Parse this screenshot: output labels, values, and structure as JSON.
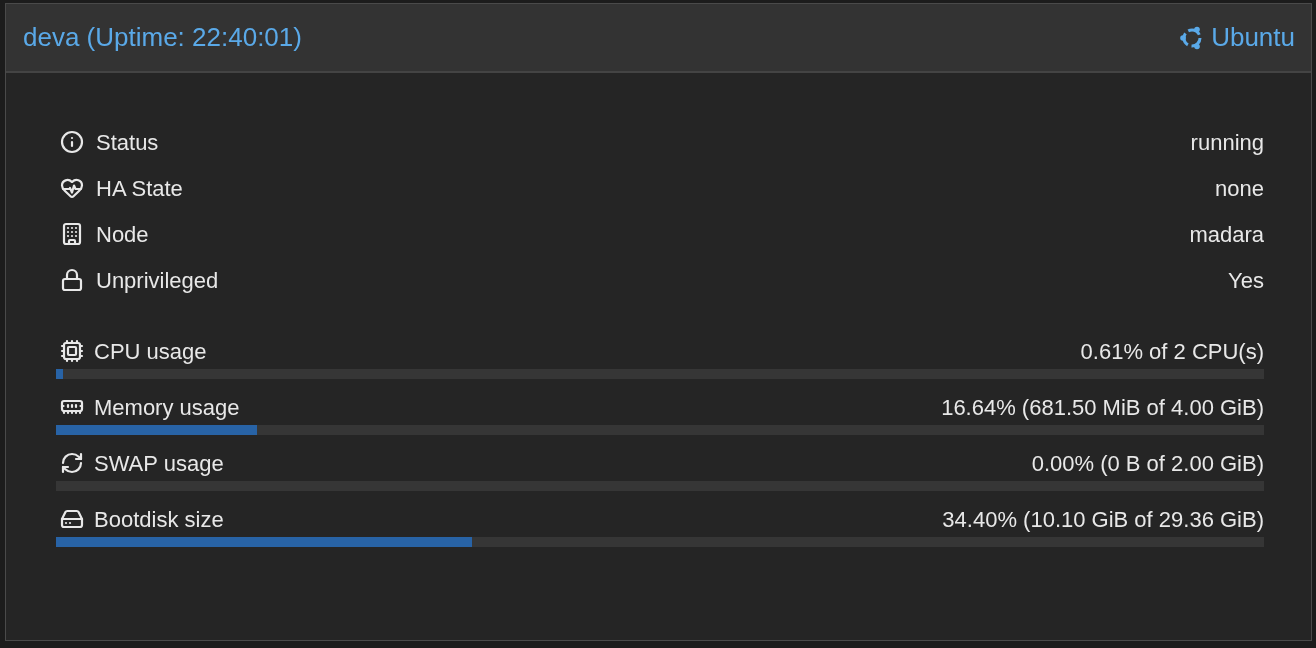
{
  "header": {
    "title": "deva (Uptime: 22:40:01)",
    "os": "Ubuntu"
  },
  "rows": [
    {
      "kind": "info",
      "label": "Status",
      "value": "running"
    },
    {
      "kind": "info",
      "label": "HA State",
      "value": "none"
    },
    {
      "kind": "info",
      "label": "Node",
      "value": "madara"
    },
    {
      "kind": "info",
      "label": "Unprivileged",
      "value": "Yes"
    },
    {
      "kind": "usage",
      "label": "CPU usage",
      "value": "0.61% of 2 CPU(s)",
      "level": 0.0061
    },
    {
      "kind": "usage",
      "label": "Memory usage",
      "value": "16.64% (681.50 MiB of 4.00 GiB)",
      "level": 0.1664
    },
    {
      "kind": "usage",
      "label": "SWAP usage",
      "value": "0.00% (0 B of 2.00 GiB)"
    },
    {
      "kind": "usage",
      "label": "Bootdisk size",
      "value": "34.40% (10.10 GiB of 29.36 GiB)",
      "level": 0.344
    }
  ]
}
